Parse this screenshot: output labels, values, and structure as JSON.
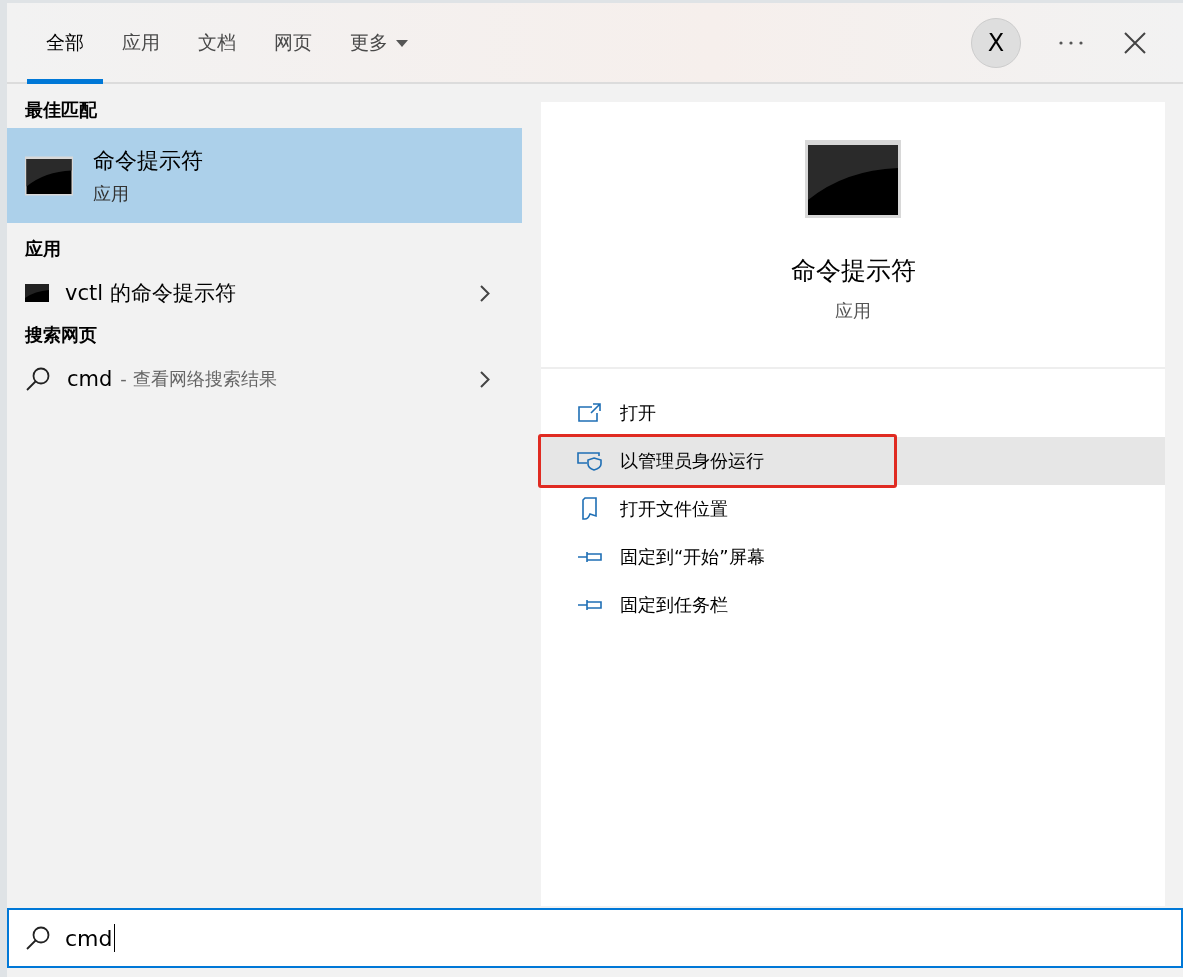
{
  "tabs": [
    {
      "label": "全部",
      "selected": true,
      "kind": "plain"
    },
    {
      "label": "应用",
      "selected": false,
      "kind": "plain"
    },
    {
      "label": "文档",
      "selected": false,
      "kind": "plain"
    },
    {
      "label": "网页",
      "selected": false,
      "kind": "plain"
    },
    {
      "label": "更多",
      "selected": false,
      "kind": "dropdown"
    }
  ],
  "user_badge": "X",
  "best_match": {
    "heading": "最佳匹配",
    "item": {
      "title": "命令提示符",
      "subtitle": "应用",
      "selected": true
    }
  },
  "sections": [
    {
      "heading": "应用",
      "items": [
        {
          "kind": "app",
          "text": "vctl 的命令提示符"
        }
      ]
    },
    {
      "heading": "搜索网页",
      "items": [
        {
          "kind": "web",
          "text": "cmd",
          "hint": "- 查看网络搜索结果"
        }
      ]
    }
  ],
  "preview": {
    "title": "命令提示符",
    "subtitle": "应用",
    "actions": [
      {
        "kind": "open",
        "label": "打开",
        "highlighted": false
      },
      {
        "kind": "admin",
        "label": "以管理员身份运行",
        "highlighted": true
      },
      {
        "kind": "folder",
        "label": "打开文件位置",
        "highlighted": false
      },
      {
        "kind": "pin",
        "label": "固定到“开始”屏幕",
        "highlighted": false
      },
      {
        "kind": "pin",
        "label": "固定到任务栏",
        "highlighted": false
      }
    ]
  },
  "search": {
    "value": "cmd"
  }
}
